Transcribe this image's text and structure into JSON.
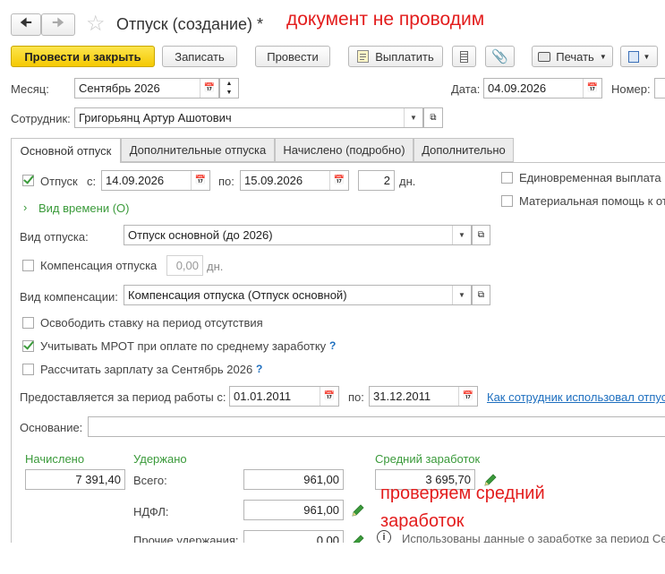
{
  "window": {
    "title": "Отпуск (создание) *",
    "annotation_top": "документ не проводим"
  },
  "toolbar": {
    "post_close": "Провести и закрыть",
    "save": "Записать",
    "post": "Провести",
    "pay": "Выплатить",
    "print": "Печать"
  },
  "header": {
    "month_label": "Месяц:",
    "month_value": "Сентябрь 2026",
    "date_label": "Дата:",
    "date_value": "04.09.2026",
    "number_label": "Номер:",
    "employee_label": "Сотрудник:",
    "employee_value": "Григорьянц Артур Ашотович"
  },
  "tabs": [
    "Основной отпуск",
    "Дополнительные отпуска",
    "Начислено (подробно)",
    "Дополнительно"
  ],
  "vacation": {
    "checkbox_label": "Отпуск",
    "from_label": "с:",
    "from_value": "14.09.2026",
    "to_label": "по:",
    "to_value": "15.09.2026",
    "days_value": "2",
    "days_unit": "дн.",
    "one_time_label": "Единовременная выплата к",
    "material_help_label": "Материальная помощь к от",
    "time_type_link": "Вид времени (О)",
    "type_label": "Вид отпуска:",
    "type_value": "Отпуск основной (до 2026)",
    "compensation_label": "Компенсация отпуска",
    "compensation_days": "0,00",
    "compensation_unit": "дн.",
    "comp_type_label": "Вид компенсации:",
    "comp_type_value": "Компенсация отпуска (Отпуск основной)",
    "free_rate_label": "Освободить ставку на период отсутствия",
    "mrot_label": "Учитывать МРОТ при оплате по среднему заработку",
    "calc_salary_label": "Рассчитать зарплату за Сентябрь 2026",
    "period_label": "Предоставляется за период работы с:",
    "period_from": "01.01.2011",
    "period_to_label": "по:",
    "period_to": "31.12.2011",
    "usage_link": "Как сотрудник использовал отпус",
    "basis_label": "Основание:",
    "basis_value": ""
  },
  "totals": {
    "accrued_label": "Начислено",
    "accrued_value": "7 391,40",
    "withheld_label": "Удержано",
    "total_label": "Всего:",
    "total_value": "961,00",
    "ndfl_label": "НДФЛ:",
    "ndfl_value": "961,00",
    "other_label": "Прочие удержания:",
    "other_value": "0,00",
    "avg_label": "Средний заработок",
    "avg_value": "3 695,70",
    "info_text": "Использованы данные о заработке за период Се",
    "annotation_line1": "проверяем средний",
    "annotation_line2": "заработок"
  },
  "colors": {
    "accent_yellow": "#f5c902",
    "green": "#3a9a3a",
    "link_blue": "#1e6fbf",
    "annotation_red": "#e31d1d"
  }
}
